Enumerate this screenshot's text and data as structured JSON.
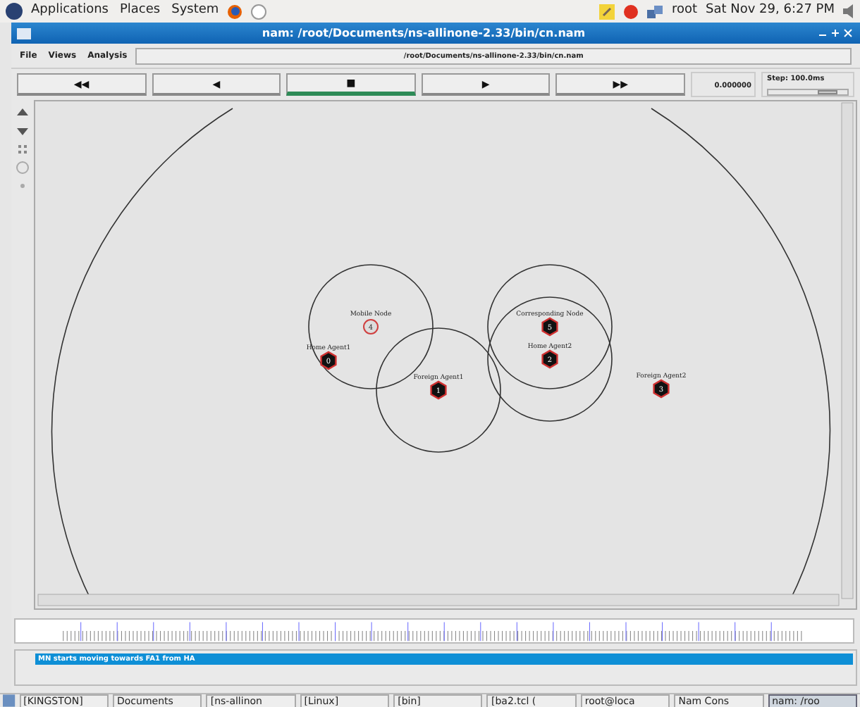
{
  "top_panel": {
    "menus": [
      "Applications",
      "Places",
      "System"
    ],
    "user": "root",
    "clock": "Sat Nov 29,  6:27 PM"
  },
  "window": {
    "title": "nam: /root/Documents/ns-allinone-2.33/bin/cn.nam"
  },
  "menu": [
    "File",
    "Views",
    "Analysis"
  ],
  "file_path": "/root/Documents/ns-allinone-2.33/bin/cn.nam",
  "controls": [
    {
      "label": "◀◀",
      "selected": false
    },
    {
      "label": "◀",
      "selected": false
    },
    {
      "label": "■",
      "selected": true
    },
    {
      "label": "▶",
      "selected": false
    },
    {
      "label": "▶▶",
      "selected": false
    }
  ],
  "time": "0.000000",
  "step": {
    "label": "Step: 100.0ms",
    "level": 0.8
  },
  "nodes": [
    {
      "label": "Mobile Node",
      "id": "4",
      "kind": "mobile"
    },
    {
      "label": "Home Agent1",
      "id": "0",
      "kind": "agent"
    },
    {
      "label": "Foreign Agent1",
      "id": "1",
      "kind": "agent"
    },
    {
      "label": "Corresponding Node",
      "id": "5",
      "kind": "agent"
    },
    {
      "label": "Home Agent2",
      "id": "2",
      "kind": "agent"
    },
    {
      "label": "Foreign Agent2",
      "id": "3",
      "kind": "agent"
    }
  ],
  "annotations": [
    {
      "text": "MN starts moving towards FA1 from HA",
      "selected": true
    }
  ],
  "taskbar": [
    {
      "label": "[KINGSTON]",
      "selected": false
    },
    {
      "label": "Documents",
      "selected": false
    },
    {
      "label": "[ns-allinon",
      "selected": false
    },
    {
      "label": "[Linux]",
      "selected": false
    },
    {
      "label": "[bin]",
      "selected": false
    },
    {
      "label": "[ba2.tcl (",
      "selected": false
    },
    {
      "label": "root@loca",
      "selected": false
    },
    {
      "label": "Nam Cons",
      "selected": false
    },
    {
      "label": "nam: /roo",
      "selected": true
    }
  ]
}
